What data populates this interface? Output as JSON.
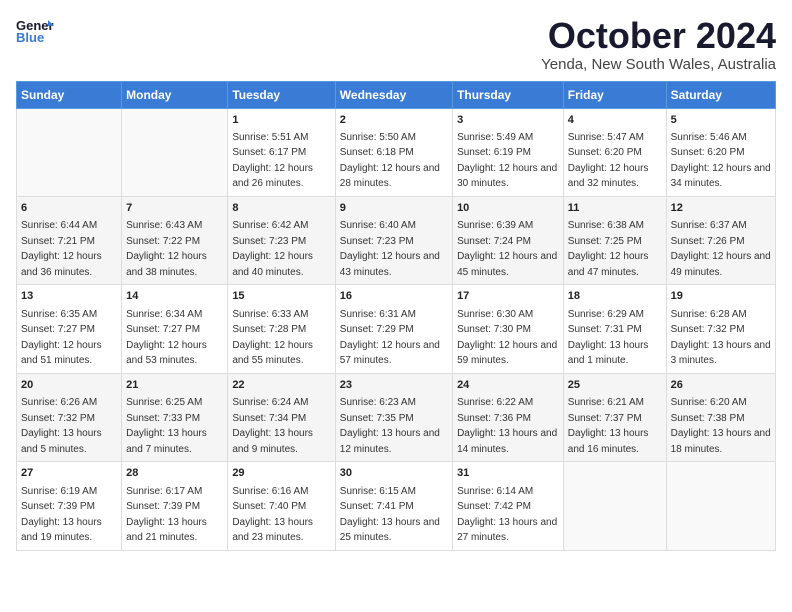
{
  "logo": {
    "line1": "General",
    "line2": "Blue"
  },
  "title": "October 2024",
  "subtitle": "Yenda, New South Wales, Australia",
  "weekdays": [
    "Sunday",
    "Monday",
    "Tuesday",
    "Wednesday",
    "Thursday",
    "Friday",
    "Saturday"
  ],
  "weeks": [
    [
      {
        "day": null,
        "sunrise": null,
        "sunset": null,
        "daylight": null
      },
      {
        "day": null,
        "sunrise": null,
        "sunset": null,
        "daylight": null
      },
      {
        "day": "1",
        "sunrise": "Sunrise: 5:51 AM",
        "sunset": "Sunset: 6:17 PM",
        "daylight": "Daylight: 12 hours and 26 minutes."
      },
      {
        "day": "2",
        "sunrise": "Sunrise: 5:50 AM",
        "sunset": "Sunset: 6:18 PM",
        "daylight": "Daylight: 12 hours and 28 minutes."
      },
      {
        "day": "3",
        "sunrise": "Sunrise: 5:49 AM",
        "sunset": "Sunset: 6:19 PM",
        "daylight": "Daylight: 12 hours and 30 minutes."
      },
      {
        "day": "4",
        "sunrise": "Sunrise: 5:47 AM",
        "sunset": "Sunset: 6:20 PM",
        "daylight": "Daylight: 12 hours and 32 minutes."
      },
      {
        "day": "5",
        "sunrise": "Sunrise: 5:46 AM",
        "sunset": "Sunset: 6:20 PM",
        "daylight": "Daylight: 12 hours and 34 minutes."
      }
    ],
    [
      {
        "day": "6",
        "sunrise": "Sunrise: 6:44 AM",
        "sunset": "Sunset: 7:21 PM",
        "daylight": "Daylight: 12 hours and 36 minutes."
      },
      {
        "day": "7",
        "sunrise": "Sunrise: 6:43 AM",
        "sunset": "Sunset: 7:22 PM",
        "daylight": "Daylight: 12 hours and 38 minutes."
      },
      {
        "day": "8",
        "sunrise": "Sunrise: 6:42 AM",
        "sunset": "Sunset: 7:23 PM",
        "daylight": "Daylight: 12 hours and 40 minutes."
      },
      {
        "day": "9",
        "sunrise": "Sunrise: 6:40 AM",
        "sunset": "Sunset: 7:23 PM",
        "daylight": "Daylight: 12 hours and 43 minutes."
      },
      {
        "day": "10",
        "sunrise": "Sunrise: 6:39 AM",
        "sunset": "Sunset: 7:24 PM",
        "daylight": "Daylight: 12 hours and 45 minutes."
      },
      {
        "day": "11",
        "sunrise": "Sunrise: 6:38 AM",
        "sunset": "Sunset: 7:25 PM",
        "daylight": "Daylight: 12 hours and 47 minutes."
      },
      {
        "day": "12",
        "sunrise": "Sunrise: 6:37 AM",
        "sunset": "Sunset: 7:26 PM",
        "daylight": "Daylight: 12 hours and 49 minutes."
      }
    ],
    [
      {
        "day": "13",
        "sunrise": "Sunrise: 6:35 AM",
        "sunset": "Sunset: 7:27 PM",
        "daylight": "Daylight: 12 hours and 51 minutes."
      },
      {
        "day": "14",
        "sunrise": "Sunrise: 6:34 AM",
        "sunset": "Sunset: 7:27 PM",
        "daylight": "Daylight: 12 hours and 53 minutes."
      },
      {
        "day": "15",
        "sunrise": "Sunrise: 6:33 AM",
        "sunset": "Sunset: 7:28 PM",
        "daylight": "Daylight: 12 hours and 55 minutes."
      },
      {
        "day": "16",
        "sunrise": "Sunrise: 6:31 AM",
        "sunset": "Sunset: 7:29 PM",
        "daylight": "Daylight: 12 hours and 57 minutes."
      },
      {
        "day": "17",
        "sunrise": "Sunrise: 6:30 AM",
        "sunset": "Sunset: 7:30 PM",
        "daylight": "Daylight: 12 hours and 59 minutes."
      },
      {
        "day": "18",
        "sunrise": "Sunrise: 6:29 AM",
        "sunset": "Sunset: 7:31 PM",
        "daylight": "Daylight: 13 hours and 1 minute."
      },
      {
        "day": "19",
        "sunrise": "Sunrise: 6:28 AM",
        "sunset": "Sunset: 7:32 PM",
        "daylight": "Daylight: 13 hours and 3 minutes."
      }
    ],
    [
      {
        "day": "20",
        "sunrise": "Sunrise: 6:26 AM",
        "sunset": "Sunset: 7:32 PM",
        "daylight": "Daylight: 13 hours and 5 minutes."
      },
      {
        "day": "21",
        "sunrise": "Sunrise: 6:25 AM",
        "sunset": "Sunset: 7:33 PM",
        "daylight": "Daylight: 13 hours and 7 minutes."
      },
      {
        "day": "22",
        "sunrise": "Sunrise: 6:24 AM",
        "sunset": "Sunset: 7:34 PM",
        "daylight": "Daylight: 13 hours and 9 minutes."
      },
      {
        "day": "23",
        "sunrise": "Sunrise: 6:23 AM",
        "sunset": "Sunset: 7:35 PM",
        "daylight": "Daylight: 13 hours and 12 minutes."
      },
      {
        "day": "24",
        "sunrise": "Sunrise: 6:22 AM",
        "sunset": "Sunset: 7:36 PM",
        "daylight": "Daylight: 13 hours and 14 minutes."
      },
      {
        "day": "25",
        "sunrise": "Sunrise: 6:21 AM",
        "sunset": "Sunset: 7:37 PM",
        "daylight": "Daylight: 13 hours and 16 minutes."
      },
      {
        "day": "26",
        "sunrise": "Sunrise: 6:20 AM",
        "sunset": "Sunset: 7:38 PM",
        "daylight": "Daylight: 13 hours and 18 minutes."
      }
    ],
    [
      {
        "day": "27",
        "sunrise": "Sunrise: 6:19 AM",
        "sunset": "Sunset: 7:39 PM",
        "daylight": "Daylight: 13 hours and 19 minutes."
      },
      {
        "day": "28",
        "sunrise": "Sunrise: 6:17 AM",
        "sunset": "Sunset: 7:39 PM",
        "daylight": "Daylight: 13 hours and 21 minutes."
      },
      {
        "day": "29",
        "sunrise": "Sunrise: 6:16 AM",
        "sunset": "Sunset: 7:40 PM",
        "daylight": "Daylight: 13 hours and 23 minutes."
      },
      {
        "day": "30",
        "sunrise": "Sunrise: 6:15 AM",
        "sunset": "Sunset: 7:41 PM",
        "daylight": "Daylight: 13 hours and 25 minutes."
      },
      {
        "day": "31",
        "sunrise": "Sunrise: 6:14 AM",
        "sunset": "Sunset: 7:42 PM",
        "daylight": "Daylight: 13 hours and 27 minutes."
      },
      {
        "day": null,
        "sunrise": null,
        "sunset": null,
        "daylight": null
      },
      {
        "day": null,
        "sunrise": null,
        "sunset": null,
        "daylight": null
      }
    ]
  ]
}
